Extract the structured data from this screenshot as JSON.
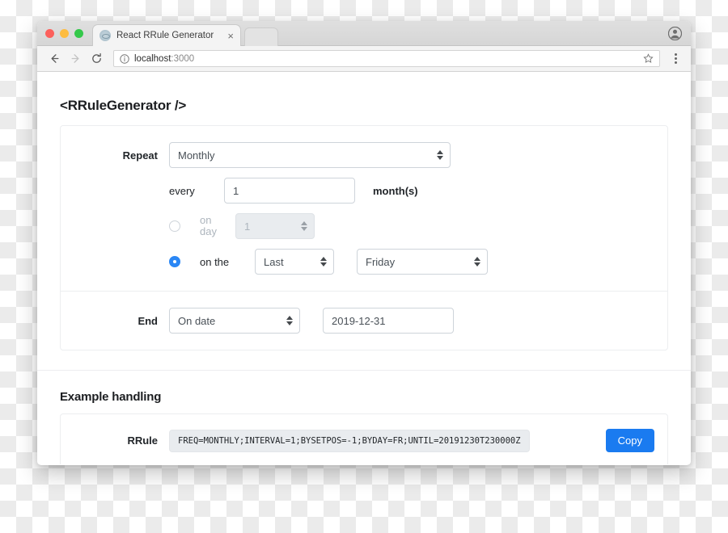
{
  "browser": {
    "tab": {
      "title": "React RRule Generator",
      "favicon": "react-favicon",
      "close": "×"
    },
    "address": {
      "host": "localhost",
      "rest": ":3000"
    },
    "icons": {
      "back": "back-arrow-icon",
      "forward": "forward-arrow-icon",
      "reload": "reload-icon",
      "info": "site-info-icon",
      "star": "bookmark-star-icon",
      "menu": "three-dot-menu-icon",
      "profile": "profile-avatar-icon"
    }
  },
  "page": {
    "title": "<RRuleGenerator />",
    "form": {
      "repeat": {
        "label": "Repeat",
        "value": "Monthly"
      },
      "every": {
        "label": "every",
        "value": "1",
        "unit": "month(s)"
      },
      "on_day": {
        "selected": false,
        "label": "on\nday",
        "label_line1": "on",
        "label_line2": "day",
        "value": "1"
      },
      "on_the": {
        "selected": true,
        "label": "on the",
        "position": "Last",
        "weekday": "Friday"
      },
      "end": {
        "label": "End",
        "mode": "On date",
        "date": "2019-12-31"
      }
    },
    "example": {
      "title": "Example handling",
      "rrule_label": "RRule",
      "rrule_value": "FREQ=MONTHLY;INTERVAL=1;BYSETPOS=-1;BYDAY=FR;UNTIL=20191230T230000Z",
      "copy_label": "Copy"
    }
  },
  "colors": {
    "accent": "#1a7bf0",
    "radio_checked": "#2b87f5",
    "code_bg": "#e9ecef",
    "border": "#ced4da"
  }
}
